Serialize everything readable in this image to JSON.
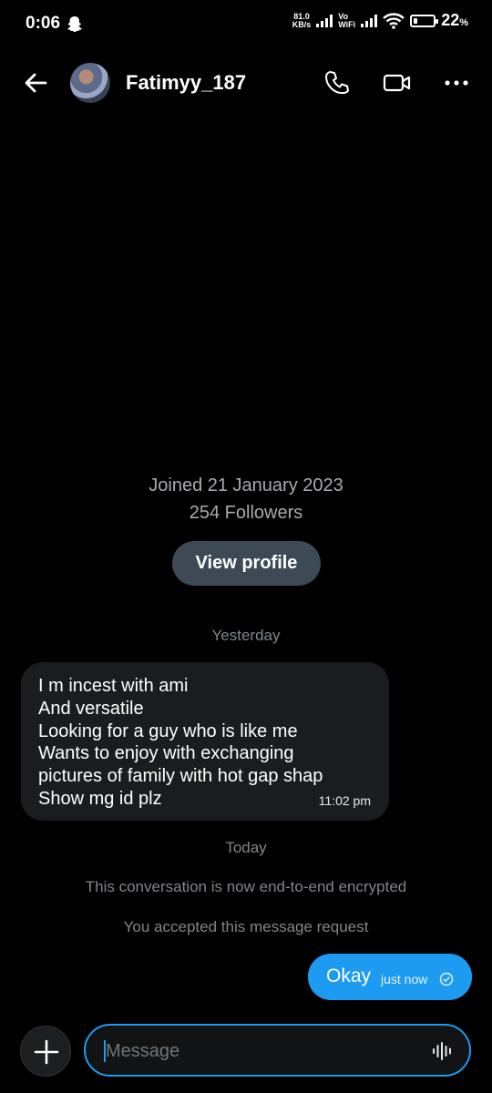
{
  "status_bar": {
    "time": "0:06",
    "speed_value": "81.0",
    "speed_unit": "KB/s",
    "volte_top": "Vo",
    "volte_bottom": "WiFi",
    "battery_percent": "22",
    "battery_pct_symbol": "%",
    "battery_level": 0.22
  },
  "header": {
    "username": "Fatimyy_187",
    "icons": [
      "back-arrow-icon",
      "phone-icon",
      "video-camera-icon",
      "more-icon"
    ]
  },
  "profile_info": {
    "joined": "Joined 21 January 2023",
    "followers": "254 Followers",
    "view_profile_label": "View profile"
  },
  "conversation": {
    "sep_yesterday": "Yesterday",
    "incoming": {
      "lines": [
        "I m incest with ami",
        "And versatile",
        "Looking for a guy who is like me",
        "Wants to enjoy with exchanging",
        "pictures of family with hot gap shap",
        "Show mg id plz"
      ],
      "time": "11:02 pm"
    },
    "sep_today": "Today",
    "system_encrypted": "This conversation is now end-to-end encrypted",
    "system_accepted": "You accepted this message request",
    "outgoing": {
      "text": "Okay",
      "time": "just now"
    }
  },
  "composer": {
    "placeholder": "Message"
  },
  "colors": {
    "accent": "#1d9bf0",
    "background": "#000000",
    "bubble_incoming": "#1a1c1f",
    "view_profile_bg": "#3d4a55"
  }
}
